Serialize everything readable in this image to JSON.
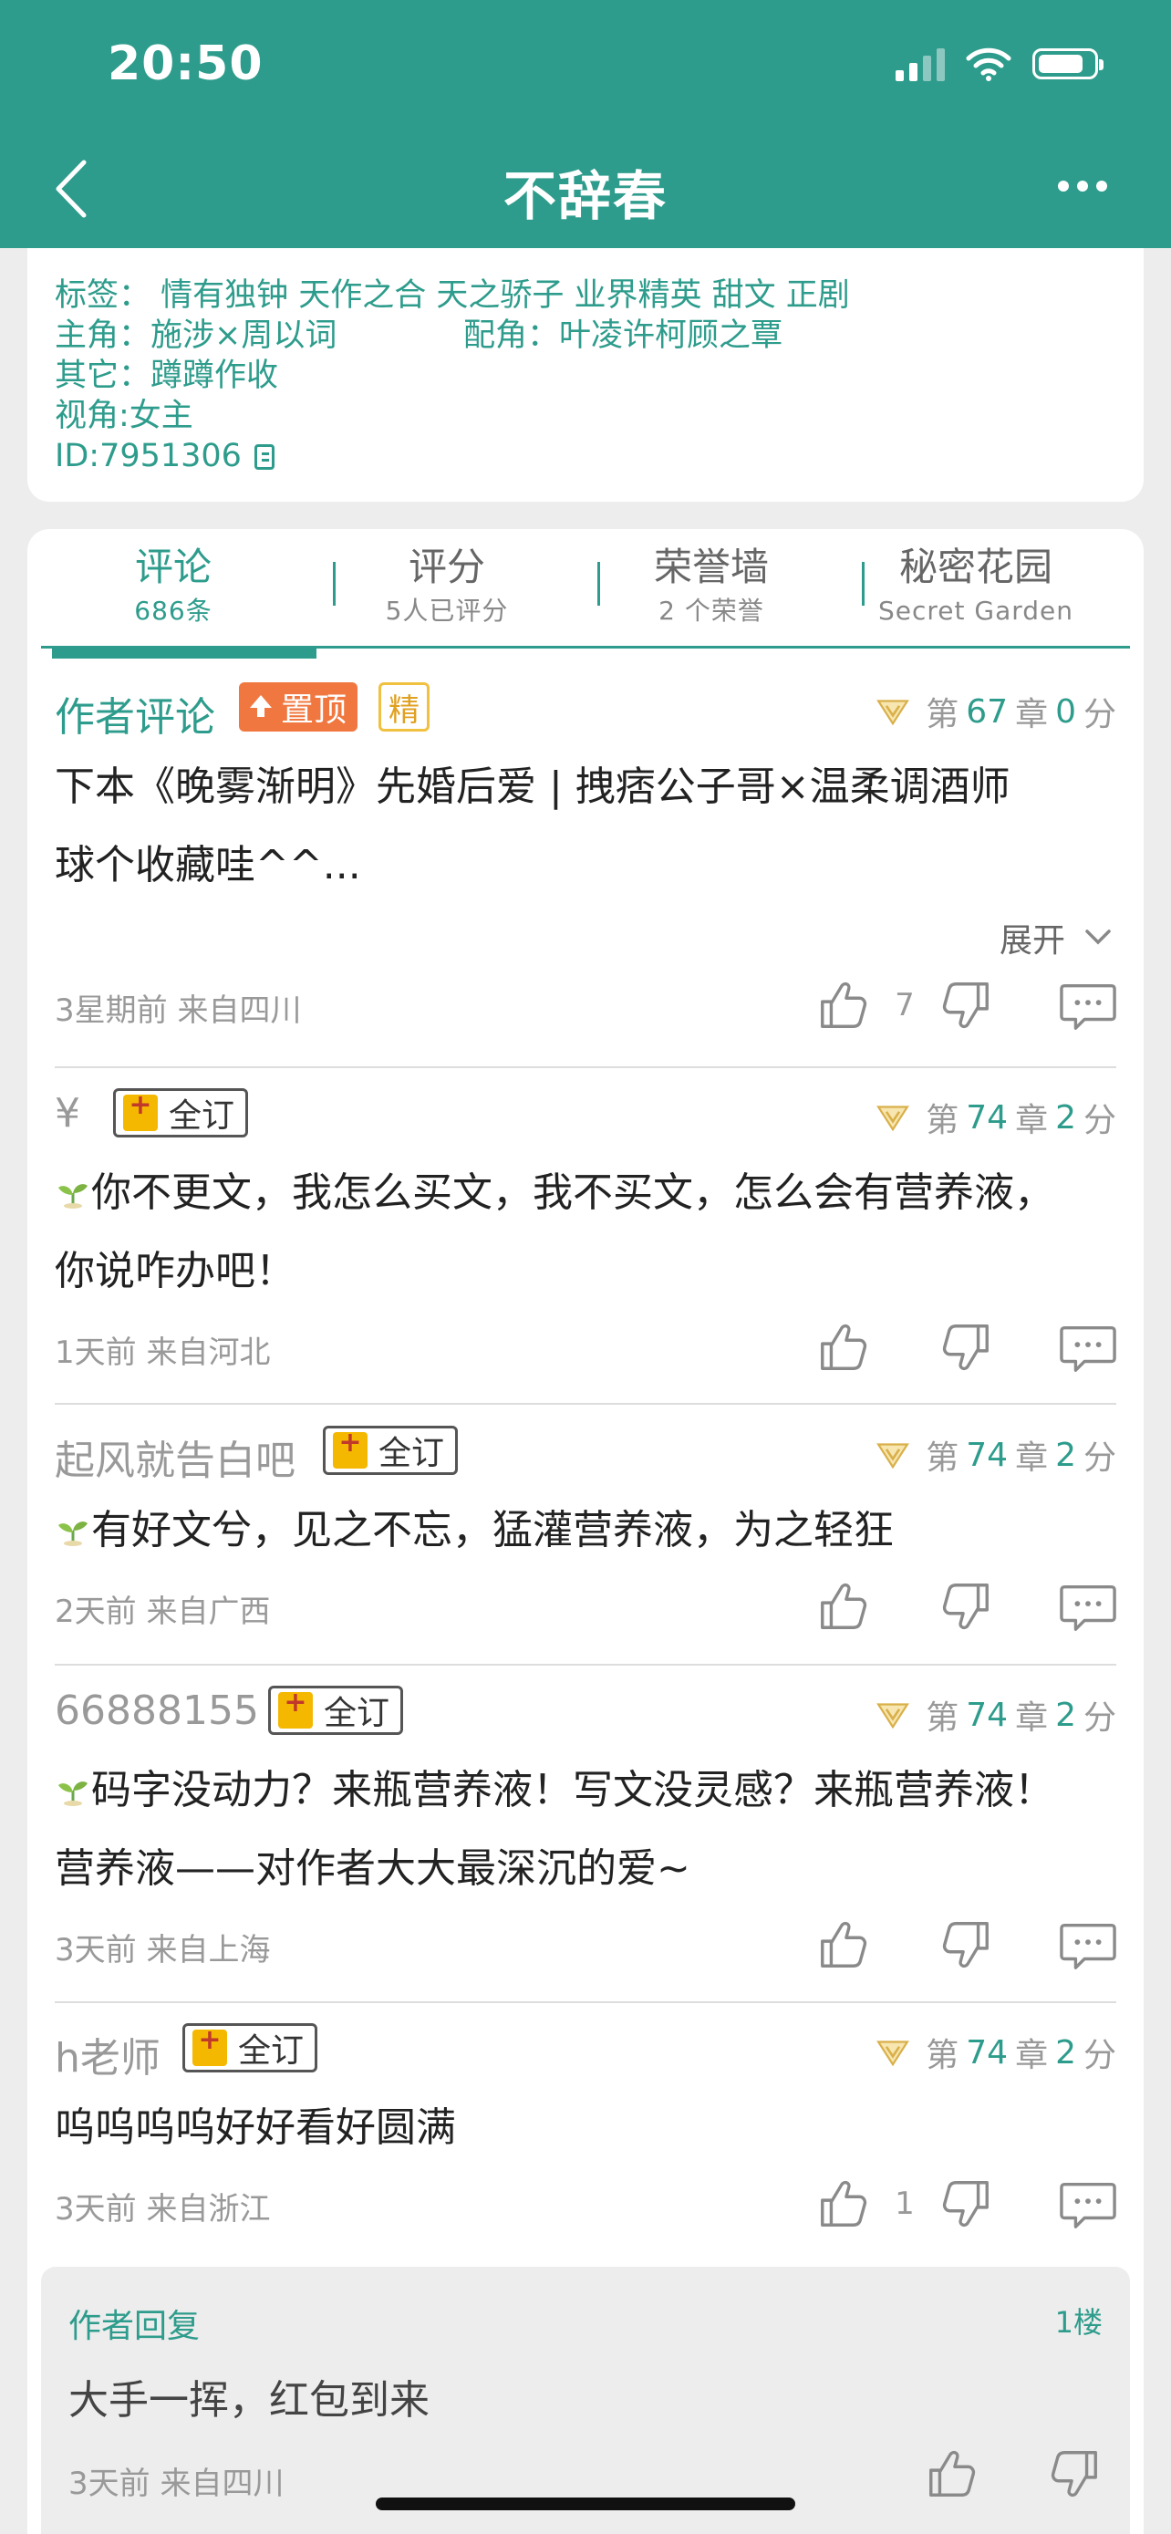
{
  "status_bar": {
    "time": "20:50"
  },
  "header": {
    "title": "不辞春"
  },
  "info": {
    "tags": "标签： 情有独钟   天作之合   天之骄子   业界精英   甜文   正剧",
    "protagonist": "主角：施涉×周以词",
    "supporting": "配角：叶凌许柯顾之覃",
    "other": "其它：蹲蹲作收",
    "perspective": "视角:女主",
    "id": "ID:7951306"
  },
  "tabs": [
    {
      "label": "评论",
      "sub": "686条"
    },
    {
      "label": "评分",
      "sub": "5人已评分"
    },
    {
      "label": "荣誉墙",
      "sub": "2 个荣誉"
    },
    {
      "label": "秘密花园",
      "sub": "Secret Garden"
    }
  ],
  "comments": [
    {
      "user": "作者评论",
      "badge_top": "置顶",
      "badge_jing": "精",
      "chapter_prefix": "第",
      "chapter": "67",
      "chapter_mid": "章",
      "score": "0",
      "score_suffix": "分",
      "line1": "下本《晚雾渐明》先婚后爱 | 拽痞公子哥×温柔调酒师",
      "line2": "球个收藏哇^^...",
      "expand": "展开",
      "meta": "3星期前  来自四川",
      "likes": "7"
    },
    {
      "user": "¥",
      "badge": "全订",
      "chapter_prefix": "第",
      "chapter": "74",
      "chapter_mid": "章",
      "score": "2",
      "score_suffix": "分",
      "line1": "你不更文，我怎么买文，我不买文，怎么会有营养液，",
      "line2": "你说咋办吧！",
      "meta": "1天前  来自河北"
    },
    {
      "user": "起风就告白吧",
      "badge": "全订",
      "chapter_prefix": "第",
      "chapter": "74",
      "chapter_mid": "章",
      "score": "2",
      "score_suffix": "分",
      "line1": "有好文兮，见之不忘，猛灌营养液，为之轻狂",
      "meta": "2天前  来自广西"
    },
    {
      "user": "66888155",
      "badge": "全订",
      "chapter_prefix": "第",
      "chapter": "74",
      "chapter_mid": "章",
      "score": "2",
      "score_suffix": "分",
      "line1": "码字没动力？来瓶营养液！写文没灵感？来瓶营养液！",
      "line2": "营养液——对作者大大最深沉的爱~",
      "meta": "3天前  来自上海"
    },
    {
      "user": "h老师",
      "badge": "全订",
      "chapter_prefix": "第",
      "chapter": "74",
      "chapter_mid": "章",
      "score": "2",
      "score_suffix": "分",
      "line1": "呜呜呜呜好好看好圆满",
      "meta": "3天前  来自浙江",
      "likes": "1"
    }
  ],
  "reply": {
    "author": "作者回复",
    "floor": "1楼",
    "text": "大手一挥，红包到来",
    "meta": "3天前  来自四川"
  },
  "colors": {
    "brand": "#2e9c8c",
    "accent_orange": "#f07840",
    "badge_gold": "#f5b800"
  }
}
